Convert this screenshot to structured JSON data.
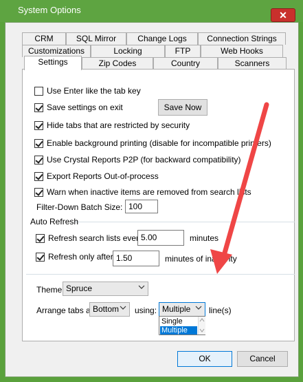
{
  "window": {
    "title": "System Options"
  },
  "tabs": {
    "row1": [
      "CRM",
      "SQL Mirror",
      "Change Logs",
      "Connection Strings"
    ],
    "row2": [
      "Customizations",
      "Locking",
      "FTP",
      "Web Hooks"
    ],
    "row3": [
      "Settings",
      "Zip Codes",
      "Country",
      "Scanners"
    ]
  },
  "settings": {
    "enter_tab": "Use Enter like the tab key",
    "save_on_exit": "Save settings on exit",
    "save_now": "Save Now",
    "hide_tabs": "Hide tabs that are restricted by security",
    "bg_printing": "Enable background printing (disable for incompatible printers)",
    "crystal": "Use Crystal Reports P2P (for backward compatibility)",
    "export_oop": "Export Reports Out-of-process",
    "warn_inactive": "Warn when inactive items are removed from search lists",
    "filter_label": "Filter-Down Batch Size:",
    "filter_value": "100"
  },
  "auto_refresh": {
    "group_label": "Auto Refresh",
    "refresh_lists": "Refresh search lists every",
    "refresh_lists_value": "5.00",
    "refresh_lists_unit": "minutes",
    "refresh_only": "Refresh only after",
    "refresh_only_value": "1.50",
    "refresh_only_unit": "minutes of inactivity"
  },
  "appearance": {
    "theme_label": "Theme:",
    "theme_value": "Spruce",
    "arrange_label": "Arrange tabs at:",
    "arrange_value": "Bottom",
    "using_label": "using:",
    "using_value": "Multiple",
    "lines_label": "line(s)",
    "options": [
      "Single",
      "Multiple"
    ]
  },
  "buttons": {
    "ok": "OK",
    "cancel": "Cancel"
  }
}
